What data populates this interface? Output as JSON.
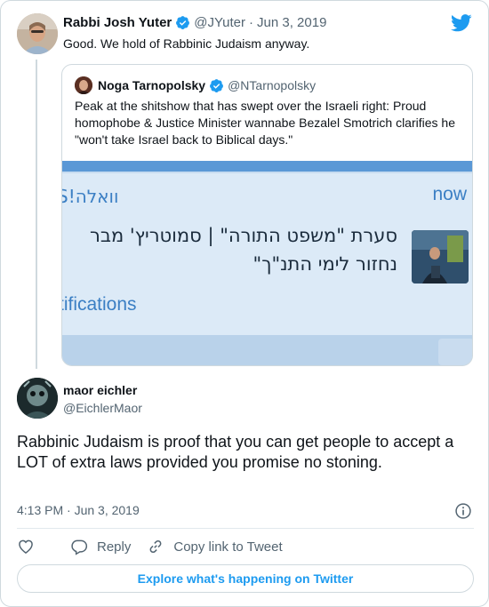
{
  "parent_tweet": {
    "display_name": "Rabbi Josh Yuter",
    "handle": "@JYuter",
    "date": "Jun 3, 2019",
    "separator": "·",
    "text": "Good. We hold of Rabbinic Judaism anyway."
  },
  "quoted_tweet": {
    "display_name": "Noga Tarnopolsky",
    "handle": "@NTarnopolsky",
    "text": "Peak at the shitshow that has swept over the Israeli right: Proud homophobe & Justice Minister wannabe Bezalel Smotrich clarifies he \"won't take Israel back to Biblical days.\"",
    "image": {
      "walla_text": "וואלה!S",
      "now_text": "now",
      "headline_line1": "סערת \"משפט התורה\" | סמוטריץ' מבר",
      "headline_line2": "נחזור לימי התנ\"ך\"",
      "notifications_text": "tifications"
    }
  },
  "main_tweet": {
    "display_name": "maor eichler",
    "handle": "@EichlerMaor",
    "text": "Rabbinic Judaism is proof that you can get people to accept a LOT of extra laws provided you promise no stoning.",
    "timestamp": "4:13 PM · Jun 3, 2019"
  },
  "actions": {
    "reply_label": "Reply",
    "copy_link_label": "Copy link to Tweet"
  },
  "footer": {
    "explore_label": "Explore what's happening on Twitter"
  },
  "icons": {
    "verified": "verified-badge-icon",
    "logo": "twitter-bird-icon",
    "info": "info-icon",
    "like": "heart-icon",
    "reply": "reply-bubble-icon",
    "link": "link-icon"
  },
  "colors": {
    "accent": "#1d9bf0",
    "secondary_text": "#536471",
    "border": "#cfd9de"
  }
}
